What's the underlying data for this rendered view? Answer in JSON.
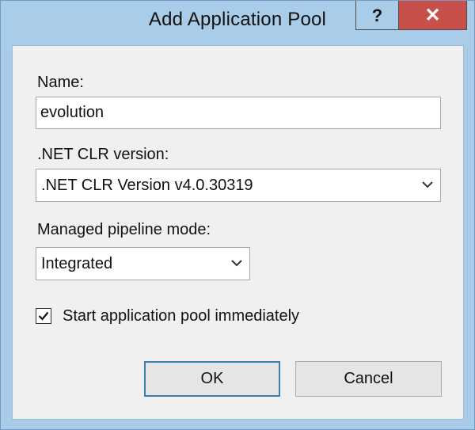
{
  "window": {
    "title": "Add Application Pool",
    "help_glyph": "?",
    "close_glyph": "✕"
  },
  "form": {
    "name_label": "Name:",
    "name_value": "evolution",
    "clr_label": ".NET CLR version:",
    "clr_value": ".NET CLR Version v4.0.30319",
    "pipeline_label": "Managed pipeline mode:",
    "pipeline_value": "Integrated",
    "start_immediately_label": "Start application pool immediately",
    "start_immediately_checked": true
  },
  "buttons": {
    "ok_label": "OK",
    "cancel_label": "Cancel"
  },
  "colors": {
    "frame": "#a9cde8",
    "close_button": "#c7504b",
    "client_background": "#f0f0f0",
    "ok_border": "#3c7fb1"
  }
}
